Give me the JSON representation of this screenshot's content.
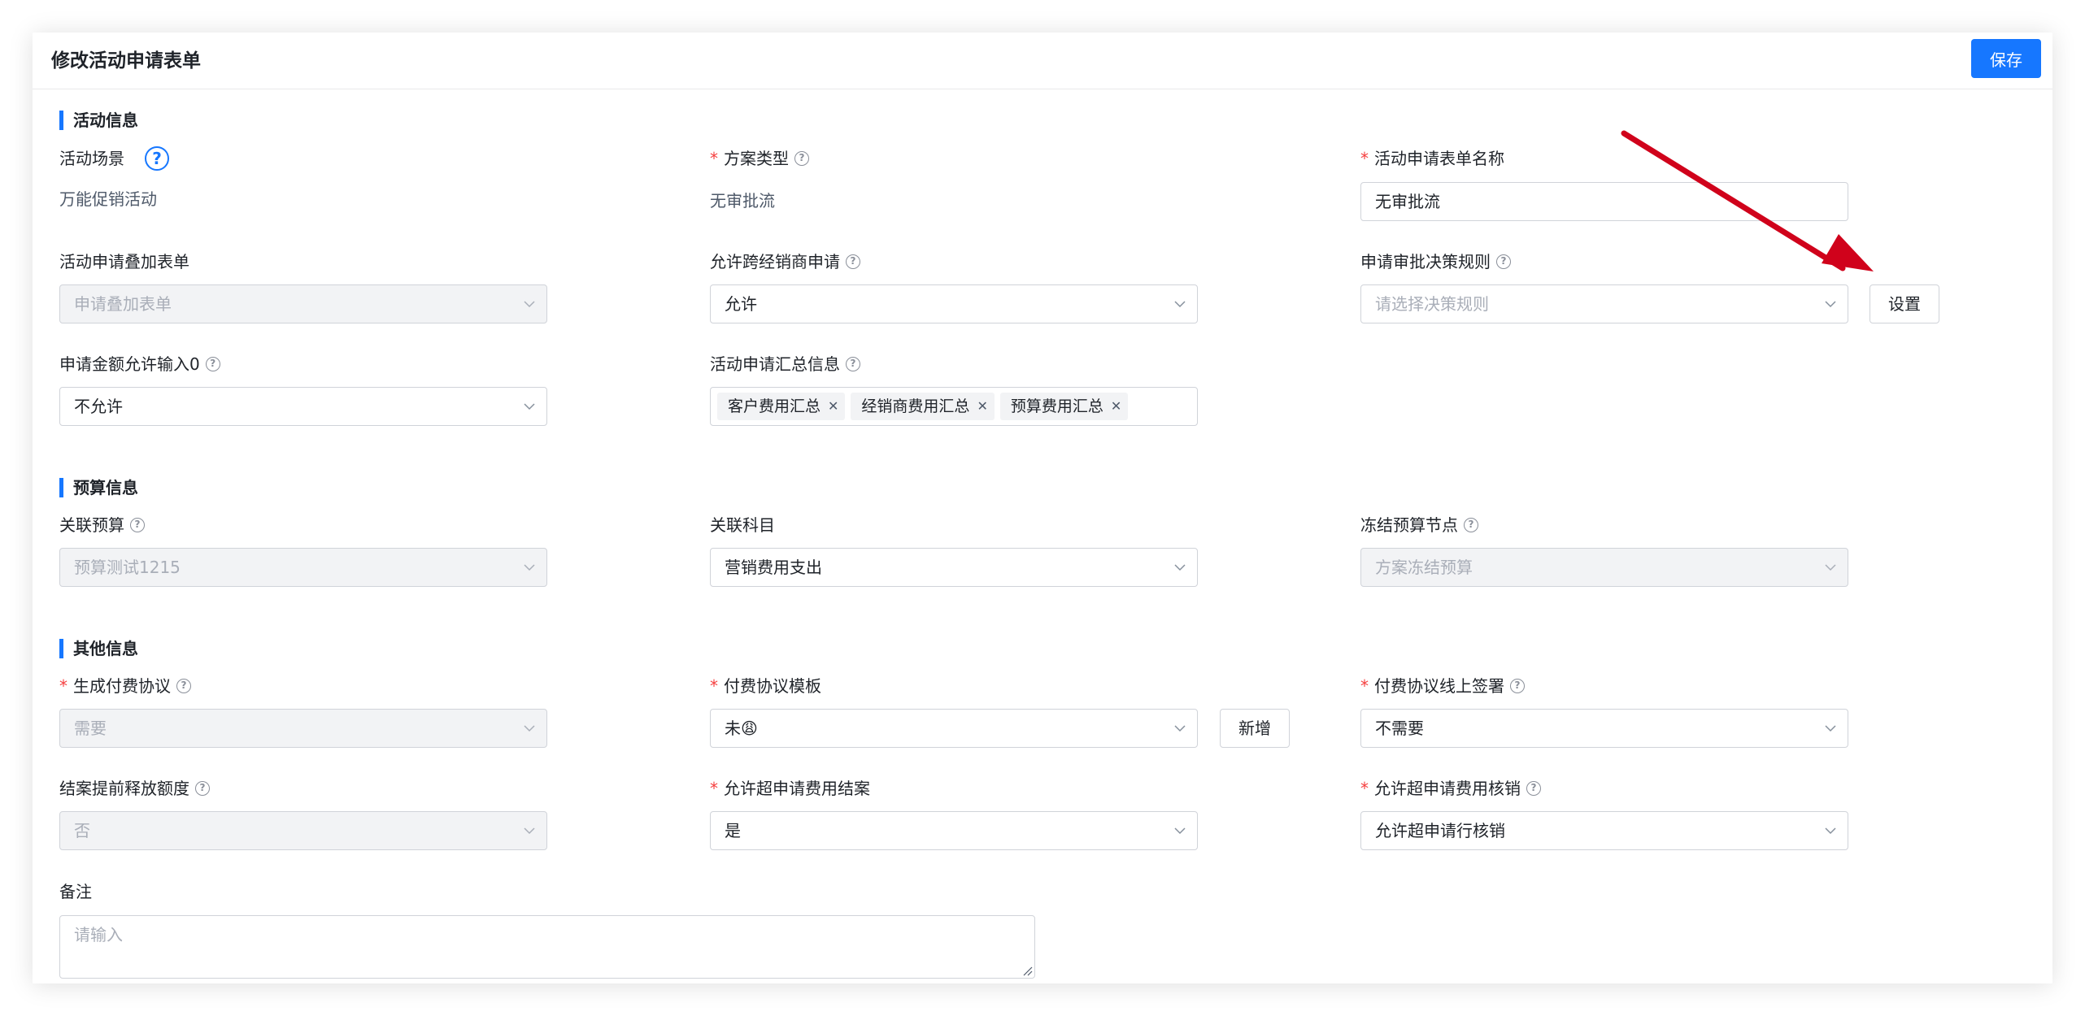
{
  "header": {
    "title": "修改活动申请表单",
    "save_label": "保存"
  },
  "sections": {
    "activity": "活动信息",
    "budget": "预算信息",
    "other": "其他信息"
  },
  "fields": {
    "scene": {
      "label": "活动场景",
      "value": "万能促销活动"
    },
    "plan_type": {
      "label": "方案类型",
      "value": "无审批流"
    },
    "form_name": {
      "label": "活动申请表单名称",
      "value": "无审批流"
    },
    "overlay_form": {
      "label": "活动申请叠加表单",
      "placeholder": "申请叠加表单"
    },
    "cross_dealer": {
      "label": "允许跨经销商申请",
      "value": "允许"
    },
    "decision_rule": {
      "label": "申请审批决策规则",
      "placeholder": "请选择决策规则",
      "button": "设置"
    },
    "zero_amount": {
      "label": "申请金额允许输入0",
      "value": "不允许"
    },
    "summary_info": {
      "label": "活动申请汇总信息",
      "tags": [
        "客户费用汇总",
        "经销商费用汇总",
        "预算费用汇总"
      ]
    },
    "linked_budget": {
      "label": "关联预算",
      "value": "预算测试1215"
    },
    "linked_subject": {
      "label": "关联科目",
      "value": "营销费用支出"
    },
    "freeze_node": {
      "label": "冻结预算节点",
      "value": "方案冻结预算"
    },
    "gen_agreement": {
      "label": "生成付费协议",
      "value": "需要"
    },
    "agreement_template": {
      "label": "付费协议模板",
      "value": "未😩",
      "button": "新增"
    },
    "online_sign": {
      "label": "付费协议线上签署",
      "value": "不需要"
    },
    "early_release": {
      "label": "结案提前释放额度",
      "value": "否"
    },
    "over_settle": {
      "label": "允许超申请费用结案",
      "value": "是"
    },
    "over_verify": {
      "label": "允许超申请费用核销",
      "value": "允许超申请行核销"
    },
    "remark": {
      "label": "备注",
      "placeholder": "请输入"
    }
  },
  "colors": {
    "accent": "#1677ff",
    "required": "#f53f3f",
    "annotation_arrow": "#d0021b"
  }
}
